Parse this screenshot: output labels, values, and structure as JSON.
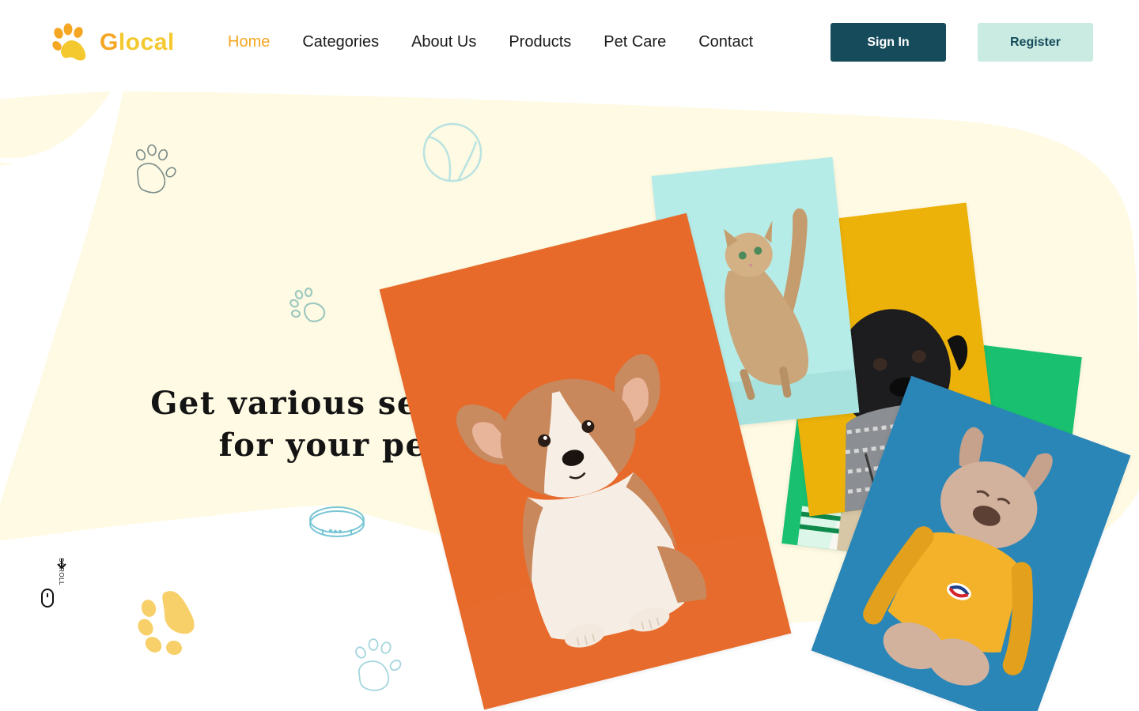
{
  "brand": {
    "name_first": "G",
    "name_rest": "local",
    "colors": {
      "primary": "#f5a623",
      "secondary": "#f4c92f"
    }
  },
  "nav": {
    "items": [
      {
        "label": "Home",
        "active": true
      },
      {
        "label": "Categories",
        "active": false
      },
      {
        "label": "About Us",
        "active": false
      },
      {
        "label": "Products",
        "active": false
      },
      {
        "label": "Pet Care",
        "active": false
      },
      {
        "label": "Contact",
        "active": false
      }
    ]
  },
  "auth": {
    "sign_in_label": "Sign In",
    "register_label": "Register"
  },
  "hero": {
    "headline_line1": "Get various services",
    "headline_line2": "for your pets"
  },
  "scroll_indicator": {
    "label": "SCROLL"
  },
  "decorations": [
    "paw-outline-icon",
    "ball-icon",
    "paw-small-icon",
    "collar-icon",
    "paw-filled-icon",
    "paw-outline-icon"
  ],
  "photos": [
    {
      "subject": "corgi puppy",
      "background": "#e76a2a"
    },
    {
      "subject": "kitten",
      "background": "#b6ece8"
    },
    {
      "subject": "pug in sweater",
      "background": "#ecb20a"
    },
    {
      "subject": "dog",
      "background": "#19c06f"
    },
    {
      "subject": "french bulldog",
      "background": "#2b86b8"
    }
  ],
  "colors": {
    "accent_dark": "#164b5b",
    "accent_light": "#c9ebe2",
    "blob": "#fffbe1"
  }
}
